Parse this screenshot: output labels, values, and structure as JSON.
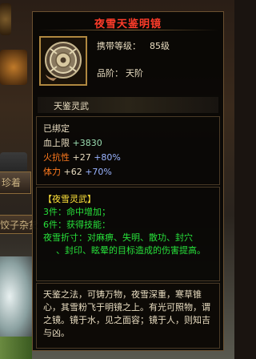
{
  "background": {
    "tab_label_1": "珍着",
    "tab_label_2": "饺子杂货"
  },
  "tooltip": {
    "title": "夜雪天鉴明镜",
    "item_icon": "bronze-mirror-icon",
    "level_label": "携带等级：",
    "level_value": "85级",
    "grade_label": "品阶：",
    "grade_value": "天阶",
    "sub_title": "天鉴灵武",
    "bound": "已绑定",
    "hp_label": "血上限",
    "hp_value": "+3830",
    "fire_label": "火抗性",
    "fire_value": "+27",
    "fire_pct": "+80%",
    "stamina_label": "体力",
    "stamina_value": "+62",
    "stamina_pct": "+70%",
    "set_name": "【夜雪灵武】",
    "set_3": "3件：命中增加；",
    "set_6": "6件：获得技能：",
    "set_effect_1": "夜雪折寸：对麻痹、失明、散功、封穴",
    "set_effect_2": "、封印、眩晕的目标造成的伤害提高。",
    "description": "天鉴之法，可铸万物，夜雪深重，寒草锥心，其雪粉飞于明镜之上。有光可照物，谓之镜。镜于水，见之面容；镜于人，则知吉与凶。"
  },
  "colors": {
    "title": "#ff3c2a",
    "set_name": "#ffe23a",
    "set_text": "#27e03a",
    "attr_label": "#ff7a1e",
    "percent": "#9ab4ff"
  }
}
